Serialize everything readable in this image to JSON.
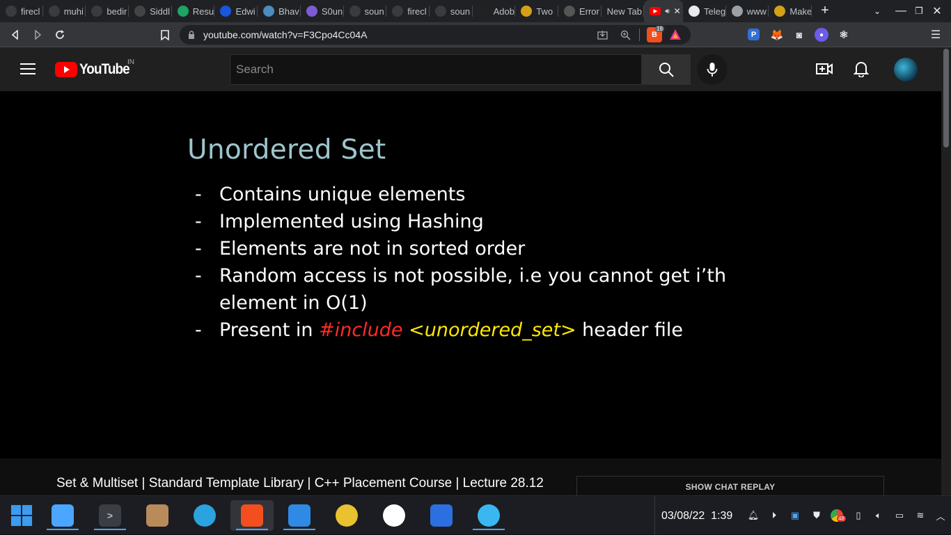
{
  "browser": {
    "tabs": [
      {
        "label": "firecl",
        "icon": "github-icon",
        "color": "#3a3b3f"
      },
      {
        "label": "muhi",
        "icon": "github-icon",
        "color": "#3a3b3f"
      },
      {
        "label": "bedir",
        "icon": "github-icon",
        "color": "#3a3b3f"
      },
      {
        "label": "Siddl",
        "icon": "sv-icon",
        "color": "#444"
      },
      {
        "label": "Resu",
        "icon": "drive-icon",
        "color": "#1ea362"
      },
      {
        "label": "Edwi",
        "icon": "edwisor-icon",
        "color": "#1a56db"
      },
      {
        "label": "Bhav",
        "icon": "globe-icon",
        "color": "#4b8bbe"
      },
      {
        "label": "S0un",
        "icon": "s0un-icon",
        "color": "#7b5cd6"
      },
      {
        "label": "soun",
        "icon": "github-icon",
        "color": "#3a3b3f"
      },
      {
        "label": "firecl",
        "icon": "github-icon",
        "color": "#3a3b3f"
      },
      {
        "label": "soun",
        "icon": "github-icon",
        "color": "#3a3b3f"
      },
      {
        "label": "Adob",
        "icon": "adobe-icon",
        "color": "#222"
      },
      {
        "label": "Two",
        "icon": "two-icon",
        "color": "#d4a017"
      },
      {
        "label": "Error",
        "icon": "cc-icon",
        "color": "#555"
      },
      {
        "label": "New Tab",
        "icon": "",
        "color": ""
      },
      {
        "label": "",
        "icon": "youtube-icon",
        "color": "#ff0000",
        "active": true
      },
      {
        "label": "Teleg",
        "icon": "globe-icon",
        "color": "#e8eaed"
      },
      {
        "label": "www",
        "icon": "g-icon",
        "color": "#9aa0a6"
      },
      {
        "label": "Make",
        "icon": "make-icon",
        "color": "#d4a017"
      }
    ],
    "url": "youtube.com/watch?v=F3Cpo4Cc04A",
    "brave_badge": "19"
  },
  "youtube": {
    "logo_text": "YouTube",
    "country": "IN",
    "search_placeholder": "Search"
  },
  "slide": {
    "title": "Unordered Set",
    "bullets": [
      {
        "dash": "-",
        "text": "Contains unique elements"
      },
      {
        "dash": "-",
        "text": "Implemented using Hashing"
      },
      {
        "dash": "-",
        "text": "Elements are not in sorted order"
      },
      {
        "dash": "-",
        "text": "Random access is not possible, i.e you cannot get i’th"
      },
      {
        "dash": "",
        "text": "element in O(1)"
      }
    ],
    "last_bullet": {
      "dash": "-",
      "prefix": "Present in ",
      "include": "#include",
      "header": " <unordered_set>",
      "suffix": " header file",
      "include_color": "#ff2a2a",
      "header_color": "#ffe800"
    }
  },
  "video": {
    "title": "Set & Multiset | Standard Template Library | C++ Placement Course | Lecture 28.12",
    "chat_replay": "SHOW CHAT REPLAY"
  },
  "taskbar": {
    "date": "03/08/22",
    "time": "1:39",
    "notif_badge": "48",
    "apps": [
      {
        "name": "start-button",
        "color": "#3b9cf0"
      },
      {
        "name": "files-app",
        "color": "#4aa6ff"
      },
      {
        "name": "terminal-app",
        "color": "#3a3d44"
      },
      {
        "name": "minecraft-app",
        "color": "#b98a5a"
      },
      {
        "name": "telegram-app",
        "color": "#2aa3df"
      },
      {
        "name": "brave-app",
        "color": "#f24e1e"
      },
      {
        "name": "vscode-app",
        "color": "#2f8ae5"
      },
      {
        "name": "chrome-beta-app",
        "color": "#e8c22f"
      },
      {
        "name": "whatsapp-app",
        "color": "#ffffff"
      },
      {
        "name": "brave-beta-app",
        "color": "#2c6fe0"
      },
      {
        "name": "flutter-app",
        "color": "#3ab7f0"
      }
    ]
  }
}
